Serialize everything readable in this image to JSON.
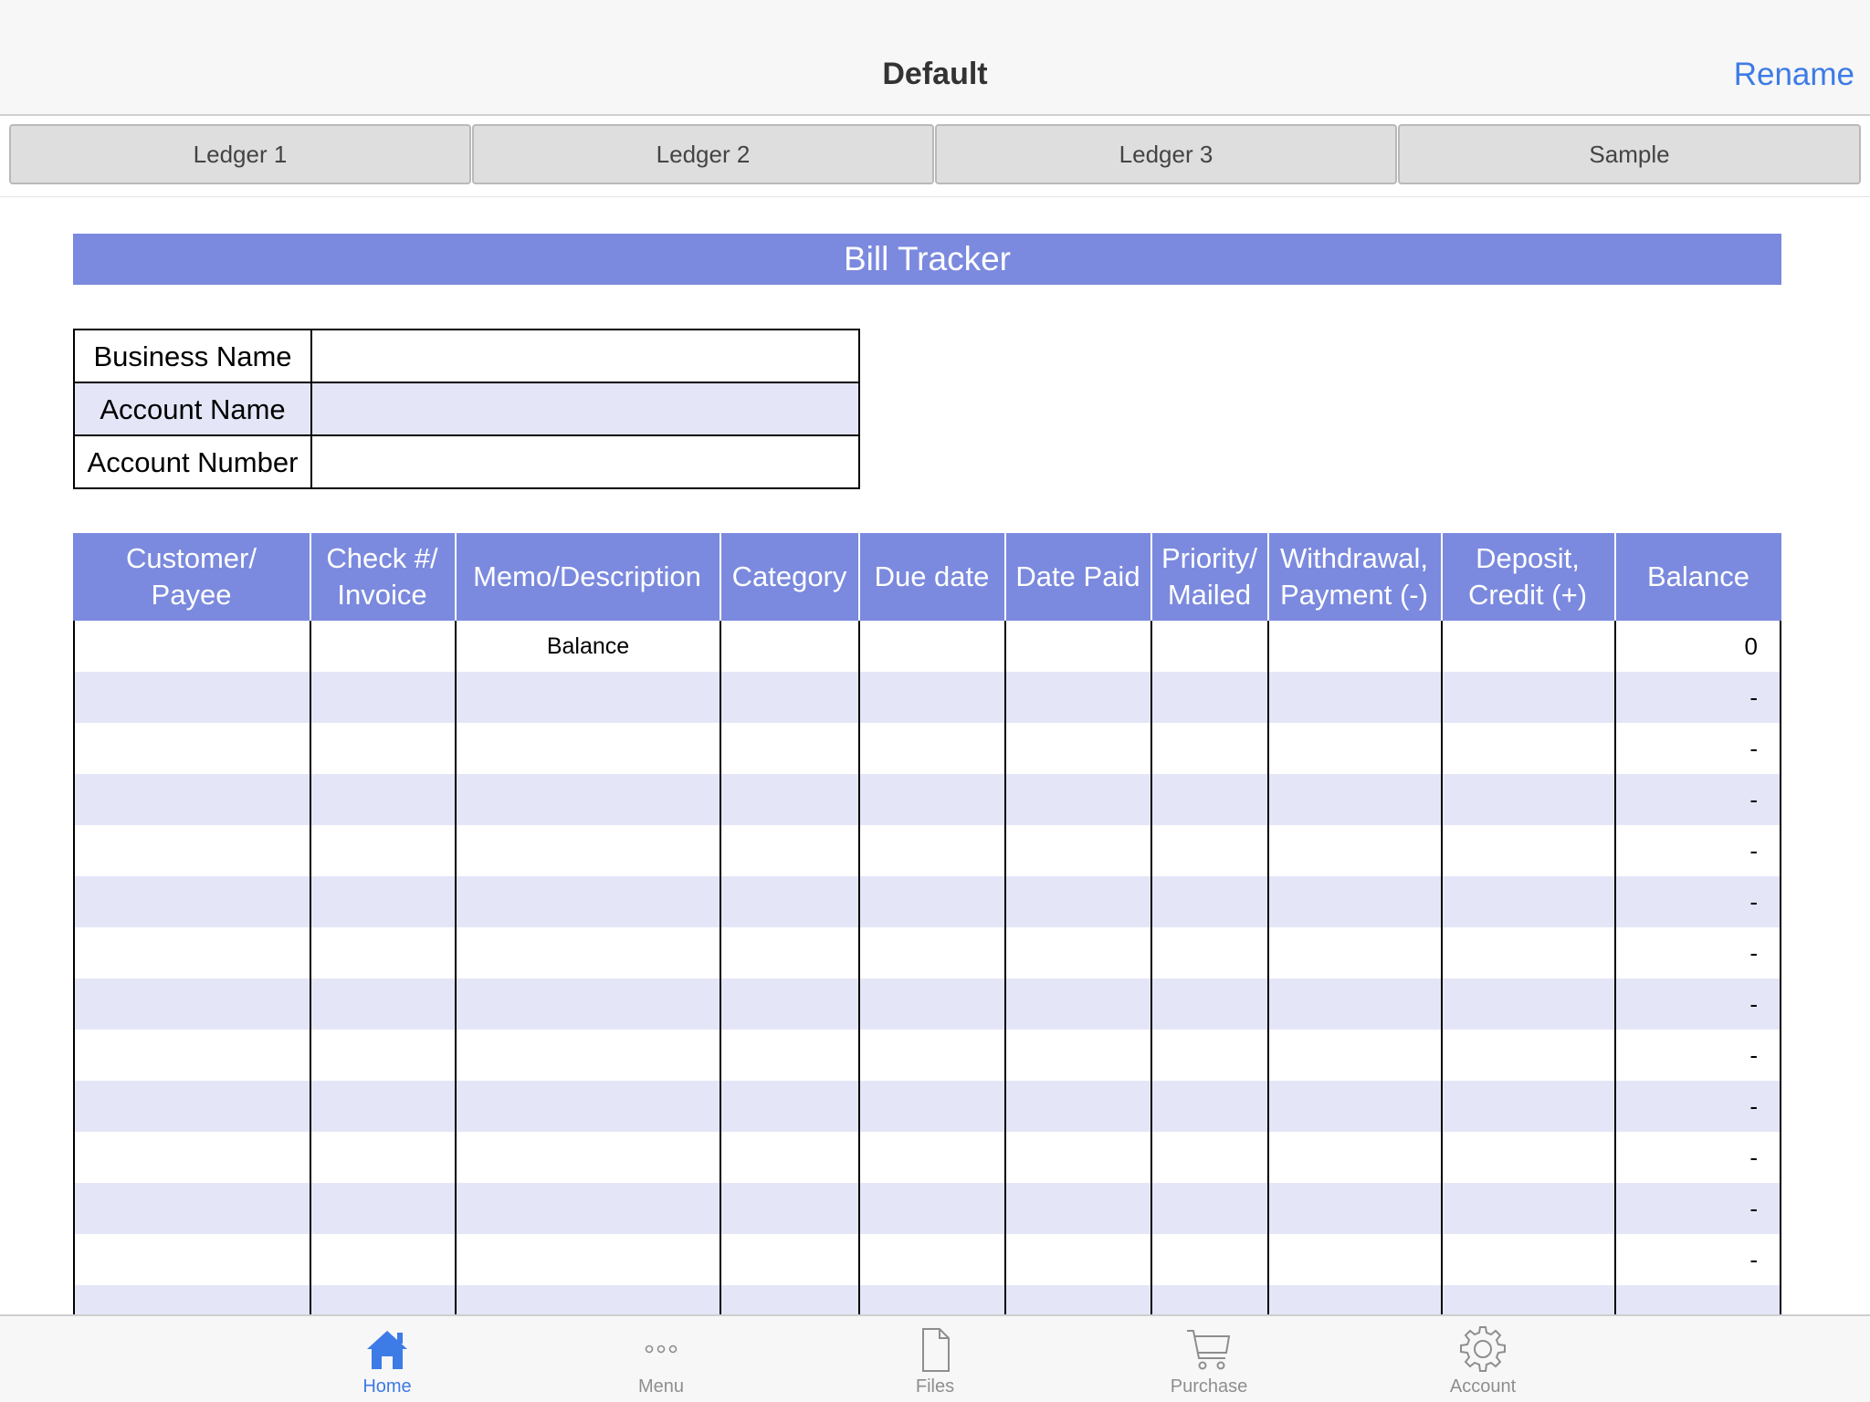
{
  "nav": {
    "title": "Default",
    "rename": "Rename"
  },
  "ledger_tabs": [
    "Ledger 1",
    "Ledger 2",
    "Ledger 3",
    "Sample"
  ],
  "sheet": {
    "title": "Bill Tracker",
    "info": [
      {
        "label": "Business Name",
        "value": ""
      },
      {
        "label": "Account Name",
        "value": ""
      },
      {
        "label": "Account Number",
        "value": ""
      }
    ],
    "columns": [
      {
        "line1": "Customer/",
        "line2": "Payee"
      },
      {
        "line1": "Check #/",
        "line2": "Invoice"
      },
      {
        "line1": "Memo/Description",
        "line2": ""
      },
      {
        "line1": "Category",
        "line2": ""
      },
      {
        "line1": "Due date",
        "line2": ""
      },
      {
        "line1": "Date Paid",
        "line2": ""
      },
      {
        "line1": "Priority/",
        "line2": "Mailed"
      },
      {
        "line1": "Withdrawal,",
        "line2": "Payment (-)"
      },
      {
        "line1": "Deposit,",
        "line2": "Credit (+)"
      },
      {
        "line1": "Balance",
        "line2": ""
      }
    ],
    "rows": [
      {
        "memo": "Balance",
        "balance": "0"
      },
      {
        "memo": "",
        "balance": "-"
      },
      {
        "memo": "",
        "balance": "-"
      },
      {
        "memo": "",
        "balance": "-"
      },
      {
        "memo": "",
        "balance": "-"
      },
      {
        "memo": "",
        "balance": "-"
      },
      {
        "memo": "",
        "balance": "-"
      },
      {
        "memo": "",
        "balance": "-"
      },
      {
        "memo": "",
        "balance": "-"
      },
      {
        "memo": "",
        "balance": "-"
      },
      {
        "memo": "",
        "balance": "-"
      },
      {
        "memo": "",
        "balance": "-"
      },
      {
        "memo": "",
        "balance": "-"
      },
      {
        "memo": "",
        "balance": ""
      }
    ]
  },
  "bottom_tabs": [
    {
      "label": "Home",
      "icon": "home-icon",
      "active": true
    },
    {
      "label": "Menu",
      "icon": "more-icon",
      "active": false
    },
    {
      "label": "Files",
      "icon": "file-icon",
      "active": false
    },
    {
      "label": "Purchase",
      "icon": "cart-icon",
      "active": false
    },
    {
      "label": "Account",
      "icon": "gear-icon",
      "active": false
    }
  ],
  "colors": {
    "accent": "#7b8ade",
    "row_shade": "#e4e6f8",
    "link": "#3d7be6"
  }
}
